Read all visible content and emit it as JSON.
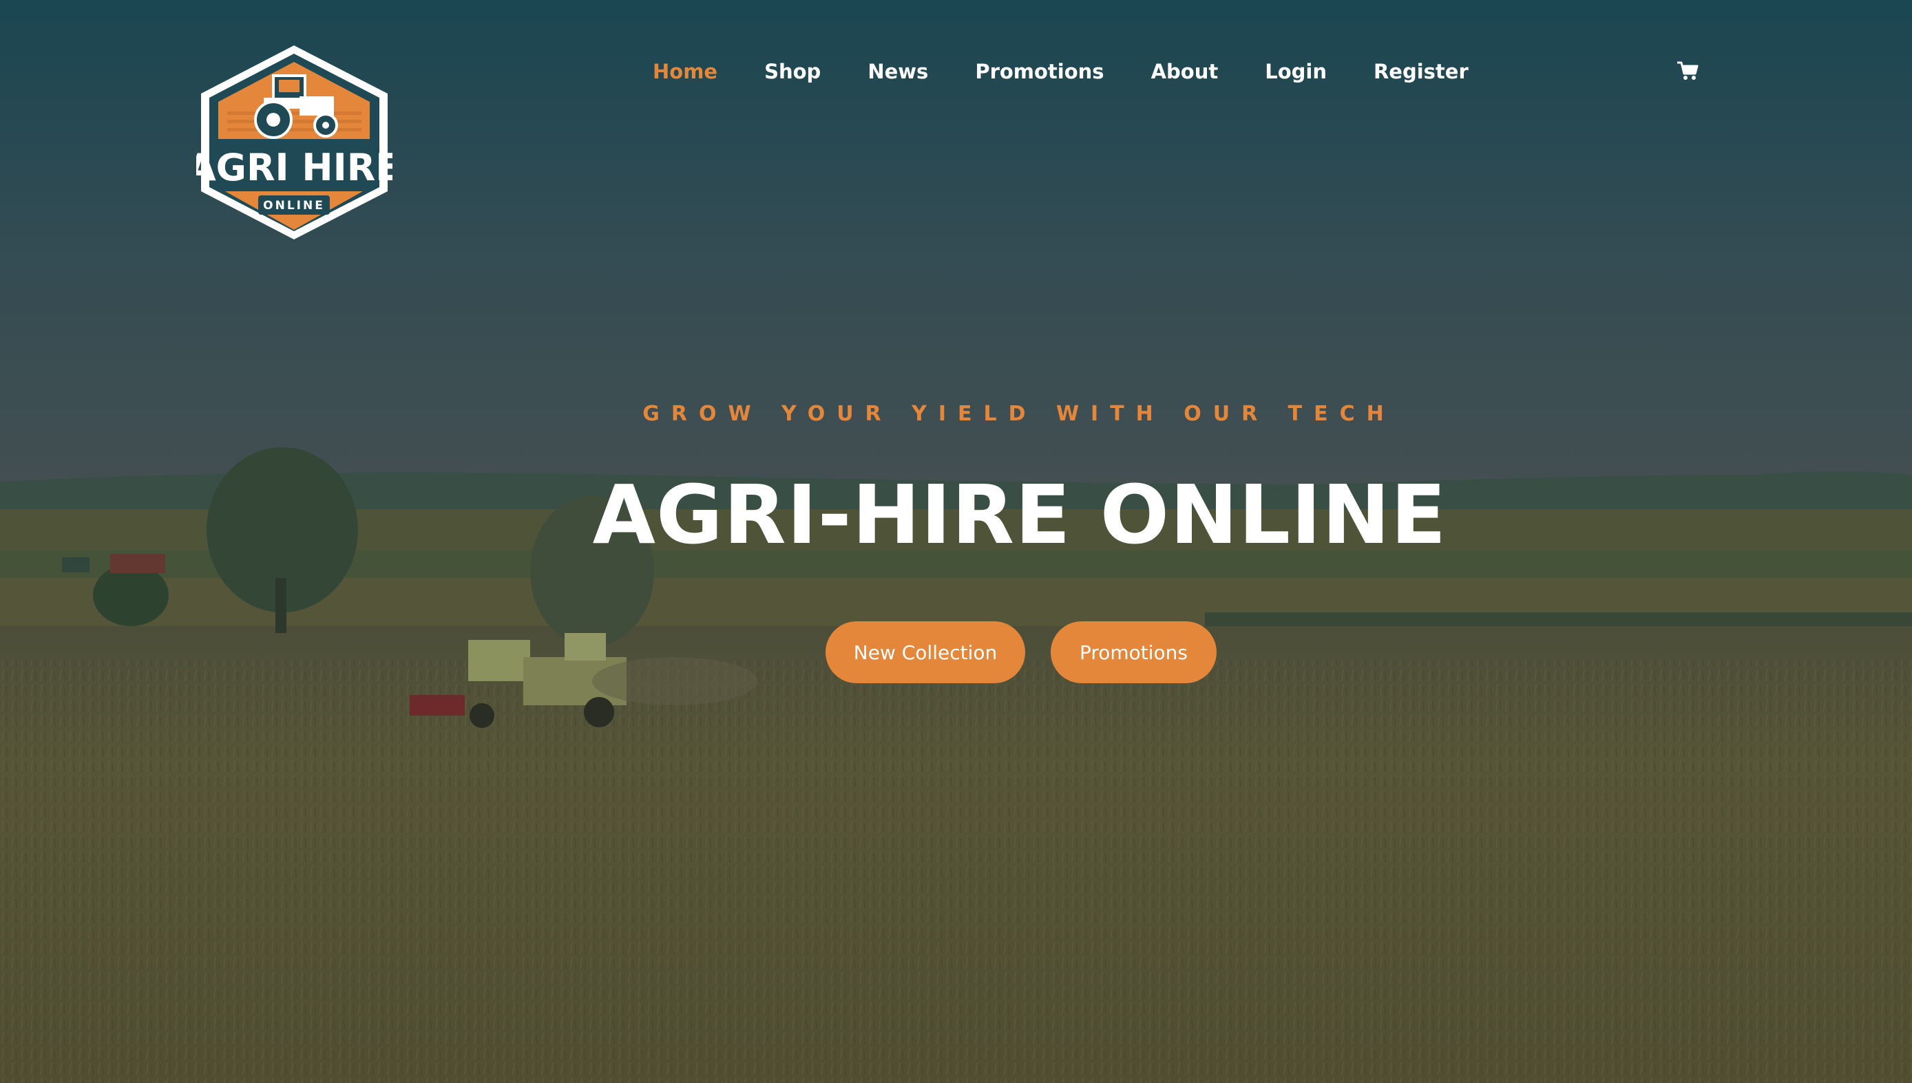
{
  "brand": {
    "logo_title": "AGRI HIRE",
    "logo_subtitle": "ONLINE",
    "logo_icon": "tractor-icon",
    "accent_color": "#e4873a",
    "logo_dark_color": "#1f4a55"
  },
  "nav": {
    "items": [
      {
        "label": "Home",
        "active": true
      },
      {
        "label": "Shop",
        "active": false
      },
      {
        "label": "News",
        "active": false
      },
      {
        "label": "Promotions",
        "active": false
      },
      {
        "label": "About",
        "active": false
      },
      {
        "label": "Login",
        "active": false
      },
      {
        "label": "Register",
        "active": false
      }
    ],
    "cart_icon": "cart-icon"
  },
  "hero": {
    "tagline": "GROW YOUR YIELD WITH OUR TECH",
    "headline": "AGRI-HIRE ONLINE",
    "buttons": {
      "new_collection": "New Collection",
      "promotions": "Promotions"
    },
    "button_color": "#e4873a"
  }
}
